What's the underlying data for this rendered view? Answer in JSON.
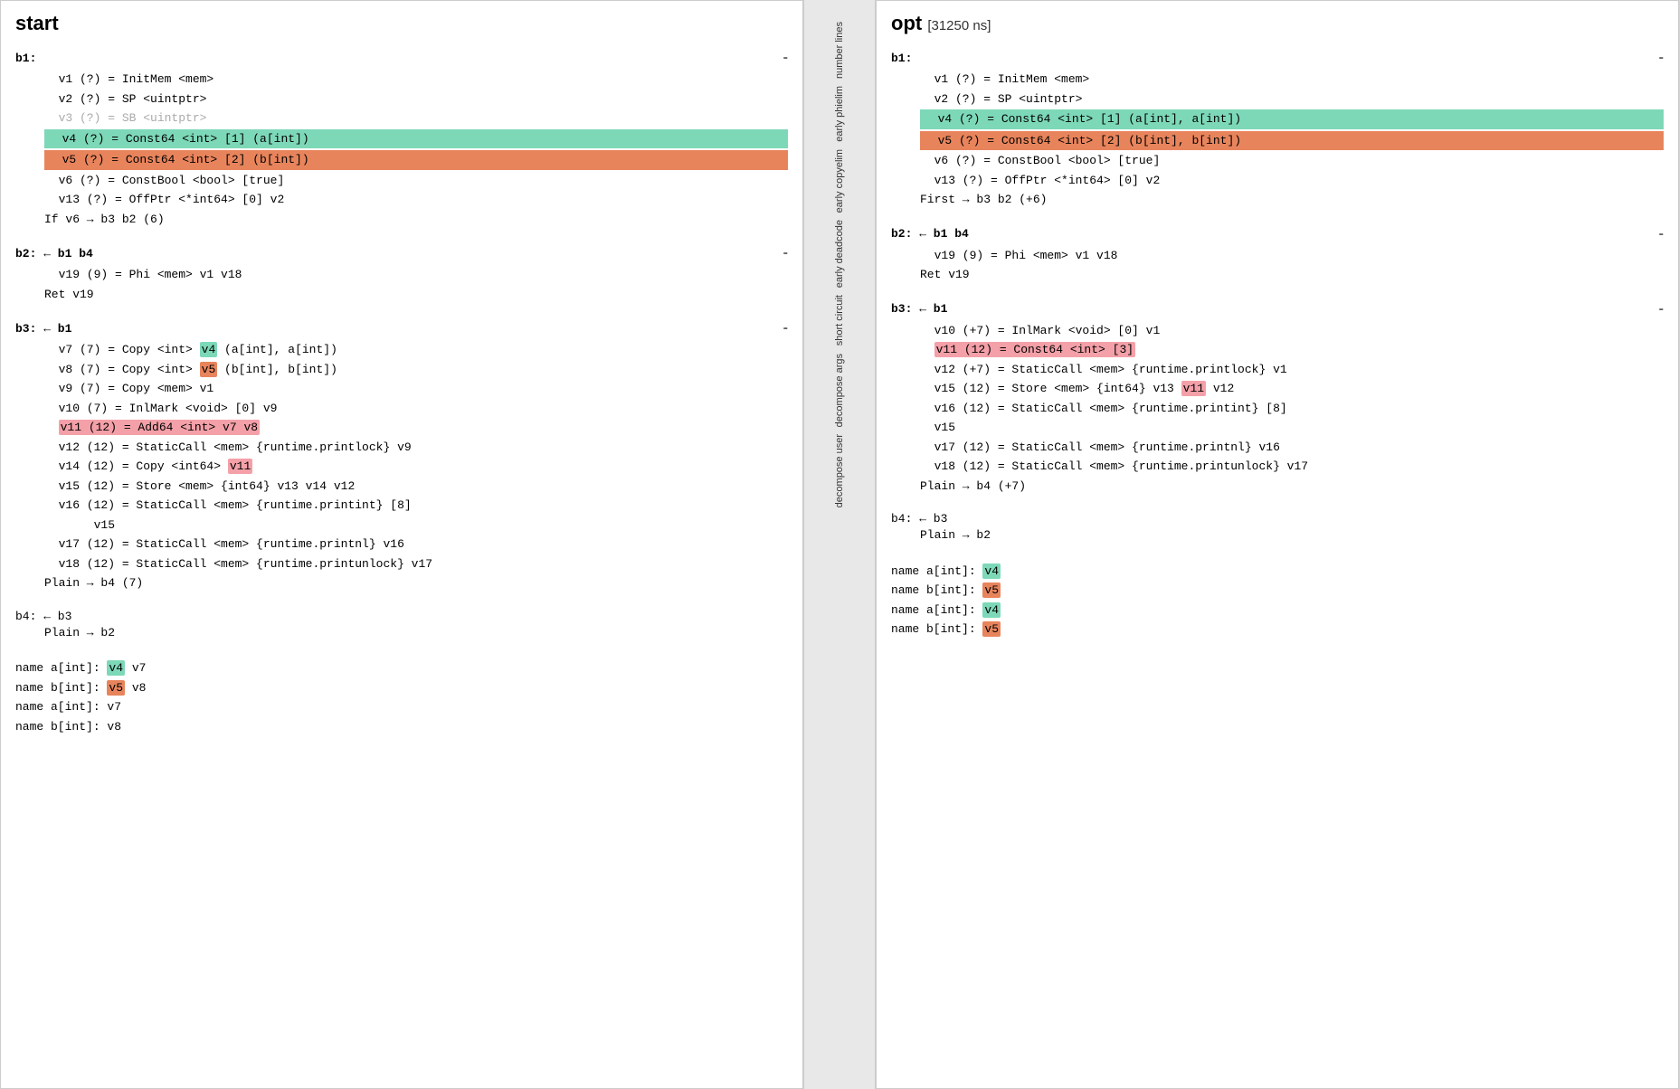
{
  "left_panel": {
    "title": "start",
    "blocks": []
  },
  "right_panel": {
    "title": "opt",
    "timing": "[31250 ns]",
    "blocks": []
  },
  "middle_labels": [
    "number lines",
    "early phielim",
    "early copyelim",
    "early deadcode",
    "short circuit",
    "decompose args",
    "decompose user"
  ]
}
